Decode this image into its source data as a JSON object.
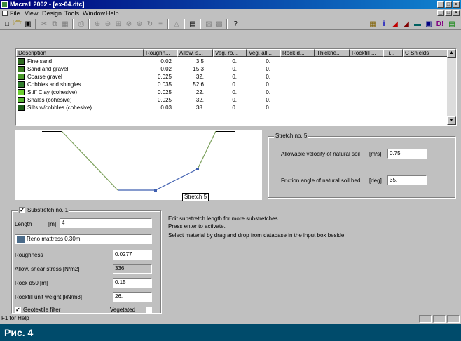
{
  "window": {
    "title": "Macra1 2002 - [ex-04.dtc]",
    "controls": [
      "_",
      "□",
      "×"
    ]
  },
  "menu": [
    "File",
    "View",
    "Design",
    "Tools",
    "Window",
    "Help"
  ],
  "toolbar": {
    "left_icons": [
      "new-file-icon",
      "open-folder-icon",
      "save-icon",
      "cut-icon",
      "copy-icon",
      "paste-icon",
      "print-icon",
      "zoom-in-icon",
      "zoom-out-icon",
      "zoom-window-icon",
      "zoom-previous-icon",
      "zoom-all-icon",
      "redraw-icon",
      "grid-icon",
      "section-icon",
      "table-icon",
      "report-icon",
      "export-icon",
      "help-icon"
    ],
    "right_icons": [
      "calculator-icon",
      "info-icon",
      "channel-section-icon",
      "bank-icon",
      "layers-icon",
      "database-icon",
      "results-icon",
      "chart-icon"
    ]
  },
  "table": {
    "columns": [
      "Description",
      "Roughn...",
      "Allow. s...",
      "Veg. ro...",
      "Veg. all...",
      "Rock d...",
      "Thickne...",
      "Rockfill ...",
      "Ti...",
      "C Shields"
    ],
    "rows": [
      {
        "desc": "Fine sand",
        "rough": "0.02",
        "allow": "3.5",
        "vegro": "0.",
        "vegall": "0.",
        "color": "#2e6b1f"
      },
      {
        "desc": "Sand and gravel",
        "rough": "0.02",
        "allow": "15.3",
        "vegro": "0.",
        "vegall": "0.",
        "color": "#3c7d22"
      },
      {
        "desc": "Coarse gravel",
        "rough": "0.025",
        "allow": "32.",
        "vegro": "0.",
        "vegall": "0.",
        "color": "#4a9a2a"
      },
      {
        "desc": "Cobbles and shingles",
        "rough": "0.035",
        "allow": "52.6",
        "vegro": "0.",
        "vegall": "0.",
        "color": "#2f7a2c"
      },
      {
        "desc": "Stiff Clay (cohesive)",
        "rough": "0.025",
        "allow": "22.",
        "vegro": "0.",
        "vegall": "0.",
        "color": "#6ccf2e"
      },
      {
        "desc": "Shales (cohesive)",
        "rough": "0.025",
        "allow": "32.",
        "vegro": "0.",
        "vegall": "0.",
        "color": "#58b634"
      },
      {
        "desc": "Silts w/cobbles (cohesive)",
        "rough": "0.03",
        "allow": "38.",
        "vegro": "0.",
        "vegall": "0.",
        "color": "#1f5f1a"
      }
    ]
  },
  "profile": {
    "stretch_label": "Stretch 5",
    "bank_color": "#7ba05b",
    "bed_color": "#3f5fb0"
  },
  "stretch_panel": {
    "title": "Stretch no. 5",
    "velocity_label": "Allowable velocity of natural soil",
    "velocity_unit": "[m/s]",
    "velocity_value": "0.75",
    "friction_label": "Friction angle of natural soil bed",
    "friction_unit": "[deg]",
    "friction_value": "35."
  },
  "substretch": {
    "title": "Substretch no. 1",
    "checked": true,
    "length_label": "Length",
    "length_unit": "[m]",
    "length_value": "4",
    "material": "Reno mattress 0.30m",
    "material_color": "#4a6b8a",
    "roughness_label": "Roughness",
    "roughness_value": "0.0277",
    "shear_label": "Allow. shear stress [N/m2]",
    "shear_value": "336.",
    "rock_label": "Rock d50 [m]",
    "rock_value": "0.15",
    "rockfill_label": "Rockfill unit weight [kN/m3]",
    "rockfill_value": "26.",
    "geotextile_label": "Geotextile filter",
    "geotextile_checked": true,
    "vegetated_label": "Vegetated",
    "vegetated_checked": false
  },
  "help_text": {
    "line1": "Edit substretch length for more substretches.",
    "line2": "Press enter to activate.",
    "line3": "Select material by drag and drop from database in the input box beside."
  },
  "status": "F1 for Help",
  "caption": "Рис. 4"
}
